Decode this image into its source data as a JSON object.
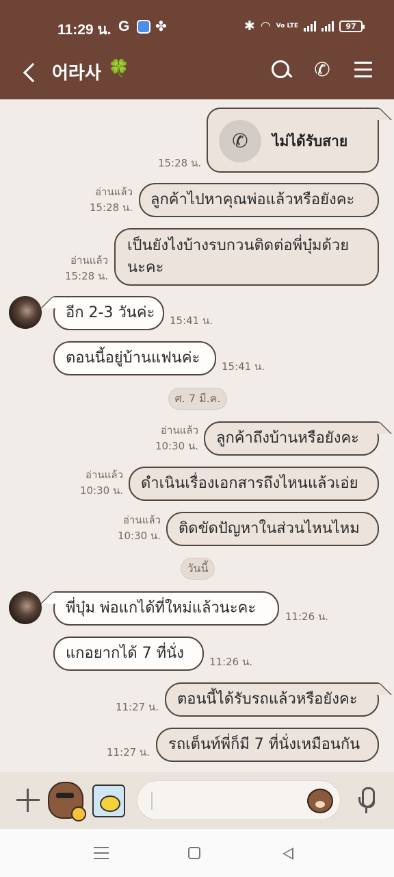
{
  "status_bar": {
    "time": "11:29 น.",
    "g_icon": "G",
    "volte": "Vo LTE",
    "battery": "97"
  },
  "header": {
    "title": "어라사",
    "title_emoji": "🍀"
  },
  "chat": {
    "missed_call": {
      "text": "ไม่ได้รับสาย",
      "time": "15:28 น."
    },
    "messages": [
      {
        "text": "ลูกค้าไปหาคุณพ่อแล้วหรือยังคะ",
        "read": "อ่านแล้ว",
        "time": "15:28 น."
      },
      {
        "line1": "เป็นยังไงบ้างรบกวนติดต่อพี่บุ๋มด้วย",
        "line2": "นะคะ",
        "read": "อ่านแล้ว",
        "time": "15:28 น."
      },
      {
        "text": "อีก 2-3 วันค่ะ",
        "time": "15:41 น."
      },
      {
        "text": "ตอนนี้อยู่บ้านแฟนค่ะ",
        "time": "15:41 น."
      },
      {
        "text": "ลูกค้าถึงบ้านหรือยังคะ",
        "read": "อ่านแล้ว",
        "time": "10:30 น."
      },
      {
        "text": "ดำเนินเรื่องเอกสารถึงไหนแล้วเอ่ย",
        "read": "อ่านแล้ว",
        "time": "10:30 น."
      },
      {
        "text": "ติดขัดปัญหาในส่วนไหนไหม",
        "read": "อ่านแล้ว",
        "time": "10:30 น."
      },
      {
        "text": "พี่บุ๋ม พ่อแกได้ที่ใหม่แล้วนะคะ",
        "time": "11:26 น."
      },
      {
        "text": "แกอยากได้ 7 ที่นั่ง",
        "time": "11:26 น."
      },
      {
        "text": "ตอนนี้ได้รับรถแล้วหรือยังคะ",
        "time": "11:27 น."
      },
      {
        "text": "รถเต็นท์พี่ก็มี 7 ที่นั่งเหมือนกัน",
        "time": "11:27 น."
      }
    ],
    "date_separators": [
      "ศ. 7 มี.ค.",
      "วันนี้"
    ]
  },
  "icons": {
    "back": "chevron-left-icon",
    "search": "search-icon",
    "call": "phone-icon",
    "menu": "hamburger-icon",
    "add": "plus-icon",
    "mic": "microphone-icon"
  },
  "colors": {
    "header_bg": "#6e4437",
    "chat_bg": "#f1ece7",
    "bubble_border": "#54463f"
  }
}
